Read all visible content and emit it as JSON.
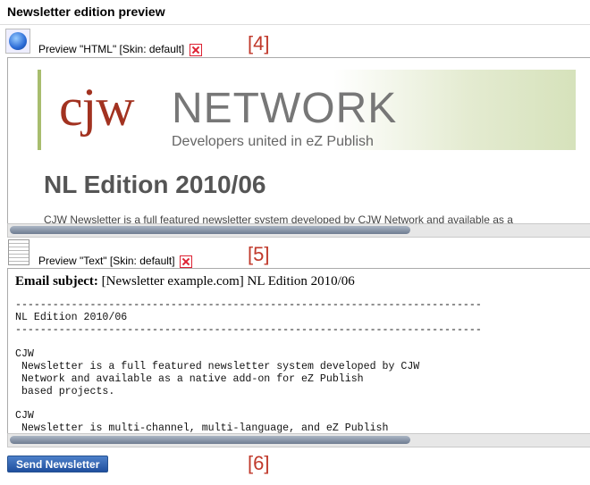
{
  "section_title": "Newsletter edition preview",
  "html_preview": {
    "label": "Preview \"HTML\" [Skin: default]",
    "callout": "[4]",
    "icon": "globe-icon",
    "close_icon": "close-icon",
    "banner": {
      "logo_mark": "cjw",
      "logo_word": "NETWORK",
      "tagline": "Developers united in eZ Publish"
    },
    "edition_title": "NL Edition 2010/06",
    "intro_line": "CJW Newsletter is a full featured newsletter system developed by CJW Network and available as a"
  },
  "text_preview": {
    "label": "Preview \"Text\" [Skin: default]",
    "callout": "[5]",
    "icon": "document-icon",
    "close_icon": "close-icon",
    "subject_label": "Email subject:",
    "subject_value": "[Newsletter example.com] NL Edition 2010/06",
    "body": "---------------------------------------------------------------------------\nNL Edition 2010/06\n---------------------------------------------------------------------------\n\nCJW\n Newsletter is a full featured newsletter system developed by CJW\n Network and available as a native add-on for eZ Publish\n based projects.\n\nCJW\n Newsletter is multi-channel, multi-language, and eZ Publish"
  },
  "send_button": {
    "label": "Send Newsletter",
    "callout": "[6]"
  },
  "colors": {
    "accent": "#1f4f9e",
    "callout": "#c0392b",
    "logo_red": "#a23220"
  }
}
